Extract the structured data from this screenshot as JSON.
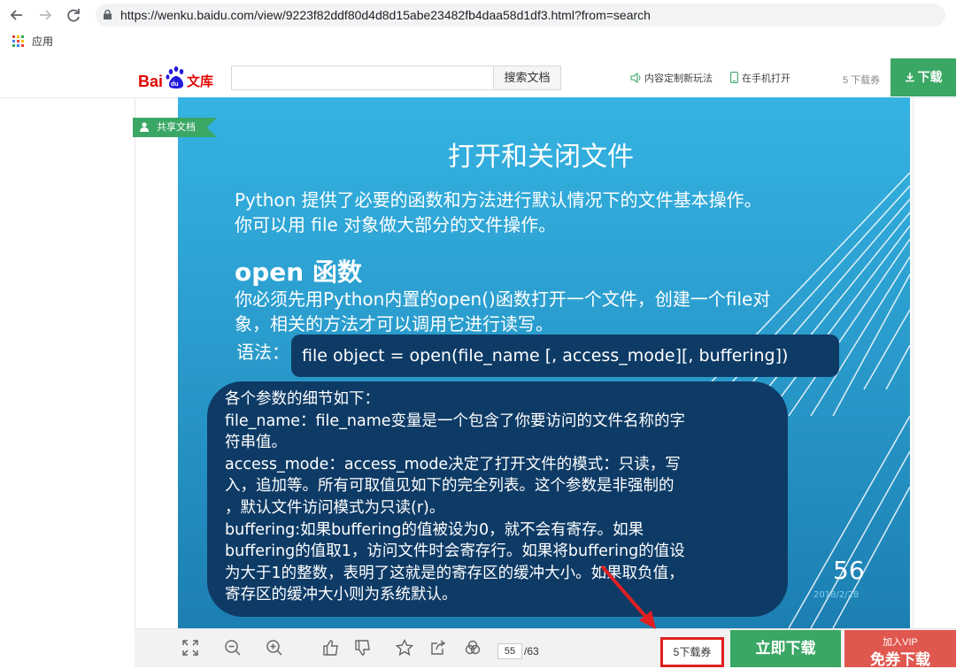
{
  "browser": {
    "url": "https://wenku.baidu.com/view/9223f82ddf80d4d8d15abe23482fb4daa58d1df3.html?from=search",
    "bookmark_apps_label": "应用",
    "icons": [
      "back-icon",
      "forward-icon",
      "reload-icon",
      "lock-icon",
      "apps-icon"
    ]
  },
  "header": {
    "logo_text": "Bai du 文库",
    "search_value": "",
    "search_button": "搜索文档",
    "link_custom": "内容定制新玩法",
    "link_phone": "在手机打开",
    "coupon_text": "5 下载券",
    "download_button": "下载",
    "colors": {
      "brand_green": "#3aa765",
      "baidu_red": "#e10601",
      "baidu_blue": "#2319dc"
    }
  },
  "document": {
    "shared_tag": "共享文档",
    "slide": {
      "title": "打开和关闭文件",
      "intro_lines": [
        "Python 提供了必要的函数和方法进行默认情况下的文件基本操作。",
        "你可以用 file 对象做大部分的文件操作。"
      ],
      "open_heading": "open 函数",
      "body_lines": [
        "你必须先用Python内置的open()函数打开一个文件，创建一个file对",
        "象，相关的方法才可以调用它进行读写。"
      ],
      "syntax_label": "语法：",
      "syntax_code": "file object = open(file_name [, access_mode][, buffering])",
      "detail_lines": [
        "各个参数的细节如下：",
        "file_name：file_name变量是一个包含了你要访问的文件名称的字",
        "符串值。",
        "access_mode：access_mode决定了打开文件的模式：只读，写",
        "入，追加等。所有可取值见如下的完全列表。这个参数是非强制的",
        "，默认文件访问模式为只读(r)。",
        "buffering:如果buffering的值被设为0，就不会有寄存。如果",
        "buffering的值取1，访问文件时会寄存行。如果将buffering的值设",
        "为大于1的整数，表明了这就是的寄存区的缓冲大小。如果取负值，",
        "寄存区的缓冲大小则为系统默认。"
      ],
      "page_number": "56",
      "date": "2018/2/28",
      "colors": {
        "bg_top": "#35b3e2",
        "bg_bottom": "#1c7fb2",
        "box": "#0e3b66"
      }
    }
  },
  "toolbar": {
    "icons": [
      "fullscreen-icon",
      "zoom-out-icon",
      "zoom-in-icon",
      "thumbs-up-icon",
      "thumbs-down-icon",
      "star-icon",
      "share-icon",
      "cloud-icon"
    ],
    "current_page": "55",
    "total_pages": "/63",
    "coupon_button": "5下载券",
    "download_now": "立即下载",
    "vip_line1": "加入VIP",
    "vip_line2": "免券下载",
    "colors": {
      "highlight_red": "#e02020",
      "vip_red": "#e0574f"
    }
  }
}
